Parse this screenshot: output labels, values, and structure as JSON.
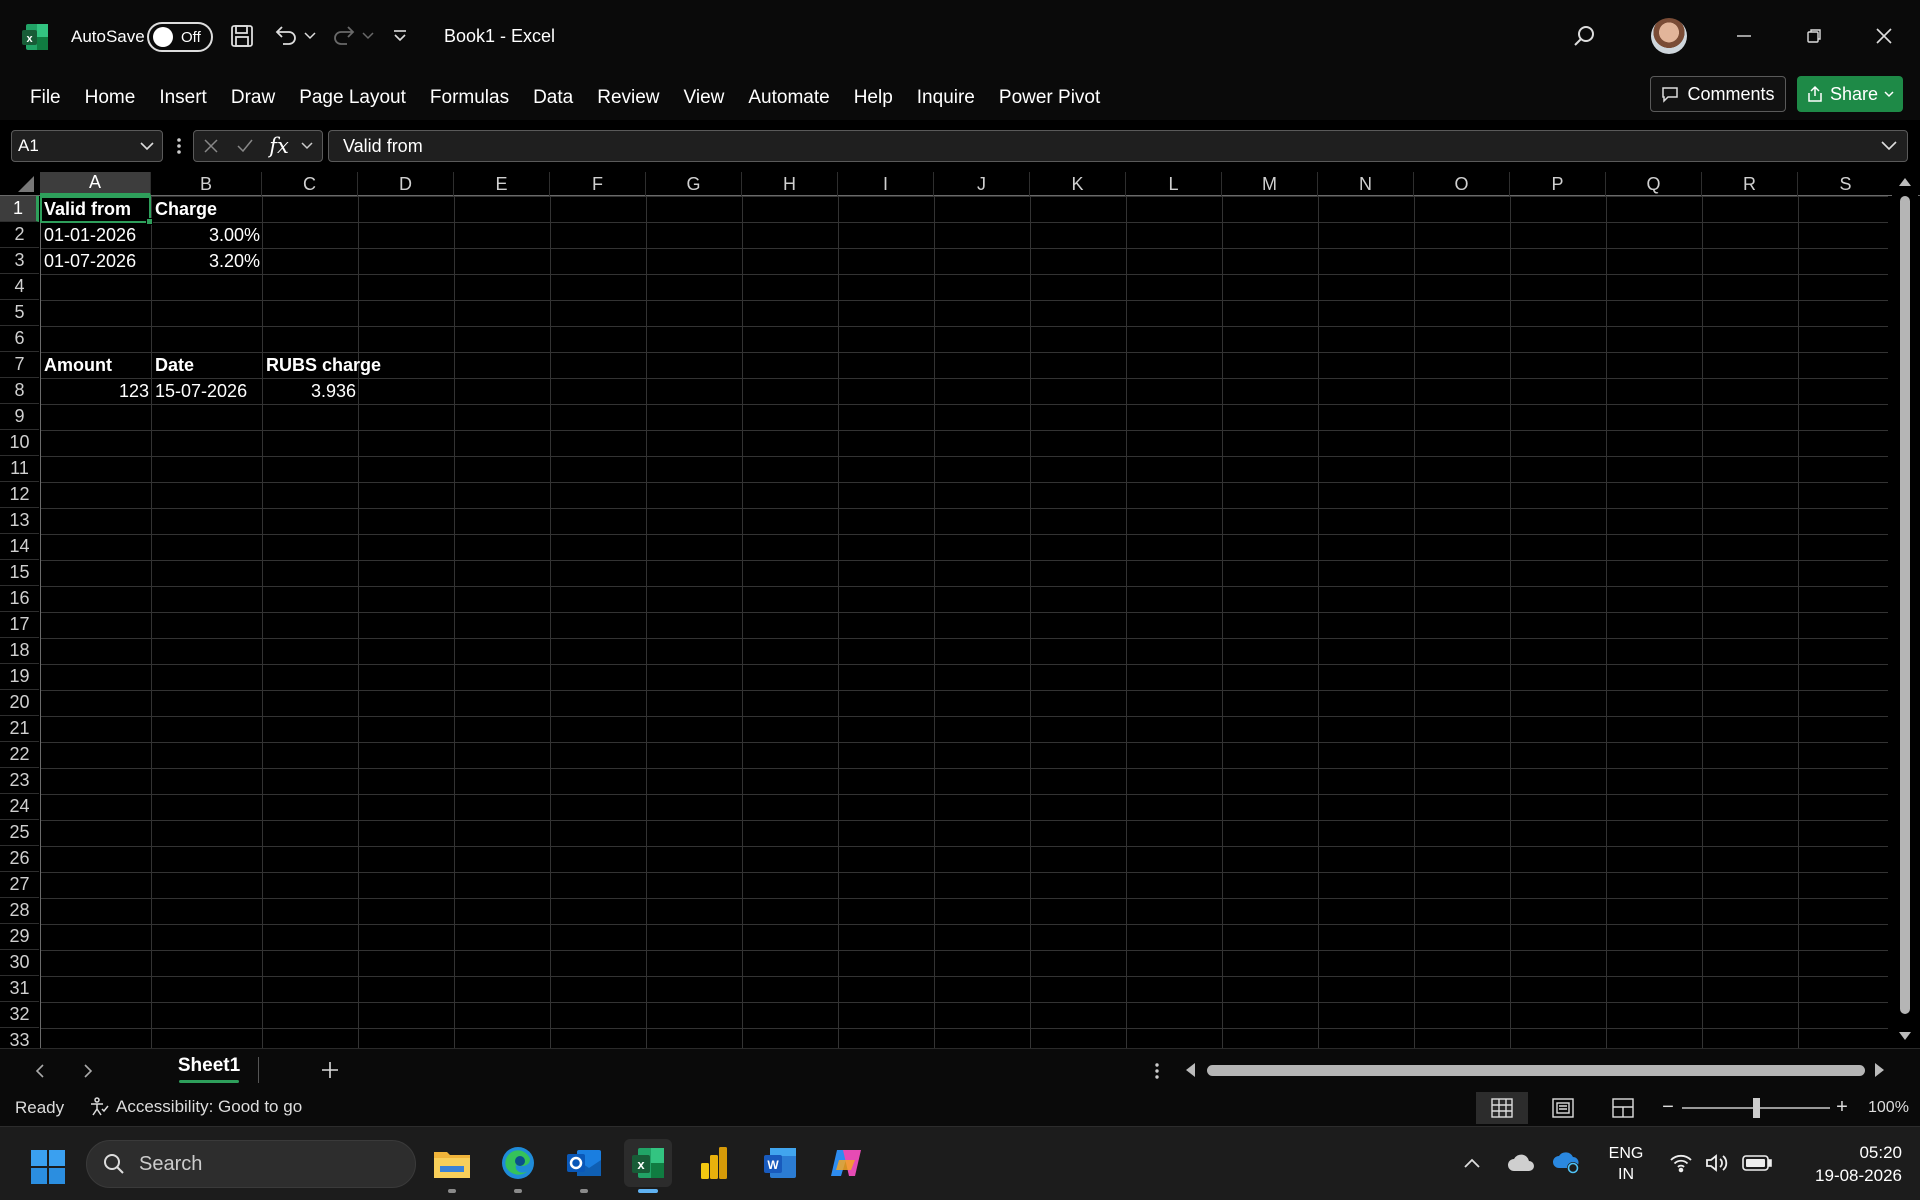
{
  "titlebar": {
    "autosave_label": "AutoSave",
    "autosave_state": "Off",
    "doc_title": "Book1  -  Excel"
  },
  "ribbon": {
    "tabs": [
      "File",
      "Home",
      "Insert",
      "Draw",
      "Page Layout",
      "Formulas",
      "Data",
      "Review",
      "View",
      "Automate",
      "Help",
      "Inquire",
      "Power Pivot"
    ],
    "comments_label": "Comments",
    "share_label": "Share"
  },
  "formula_bar": {
    "name_box": "A1",
    "fx_label": "fx",
    "formula": "Valid from"
  },
  "grid": {
    "columns": [
      "A",
      "B",
      "C",
      "D",
      "E",
      "F",
      "G",
      "H",
      "I",
      "J",
      "K",
      "L",
      "M",
      "N",
      "O",
      "P",
      "Q",
      "R",
      "S"
    ],
    "rows": [
      "1",
      "2",
      "3",
      "4",
      "5",
      "6",
      "7",
      "8",
      "9",
      "10",
      "11",
      "12",
      "13",
      "14",
      "15",
      "16",
      "17",
      "18",
      "19",
      "20",
      "21",
      "22",
      "23",
      "24",
      "25",
      "26",
      "27",
      "28",
      "29",
      "30",
      "31",
      "32",
      "33"
    ],
    "selected_cell": "A1",
    "cells": {
      "A1": "Valid from",
      "B1": "Charge",
      "A2": "01-01-2026",
      "B2": "3.00%",
      "A3": "01-07-2026",
      "B3": "3.20%",
      "A7": "Amount",
      "B7": "Date",
      "C7": "RUBS charge",
      "A8": "123",
      "B8": "15-07-2026",
      "C8": "3.936"
    }
  },
  "sheets": {
    "tabs": [
      "Sheet1"
    ],
    "active": "Sheet1"
  },
  "status": {
    "ready": "Ready",
    "accessibility": "Accessibility: Good to go",
    "zoom_minus": "−",
    "zoom_plus": "+",
    "zoom_level": "100%",
    "zoom_fraction": 0.5
  },
  "taskbar": {
    "search_placeholder": "Search",
    "lang_line1": "ENG",
    "lang_line2": "IN",
    "time": "05:20",
    "date": "19-08-2026"
  },
  "colors": {
    "accent_green": "#2e9f5b",
    "share_green": "#1e8a47",
    "background": "#000000"
  }
}
